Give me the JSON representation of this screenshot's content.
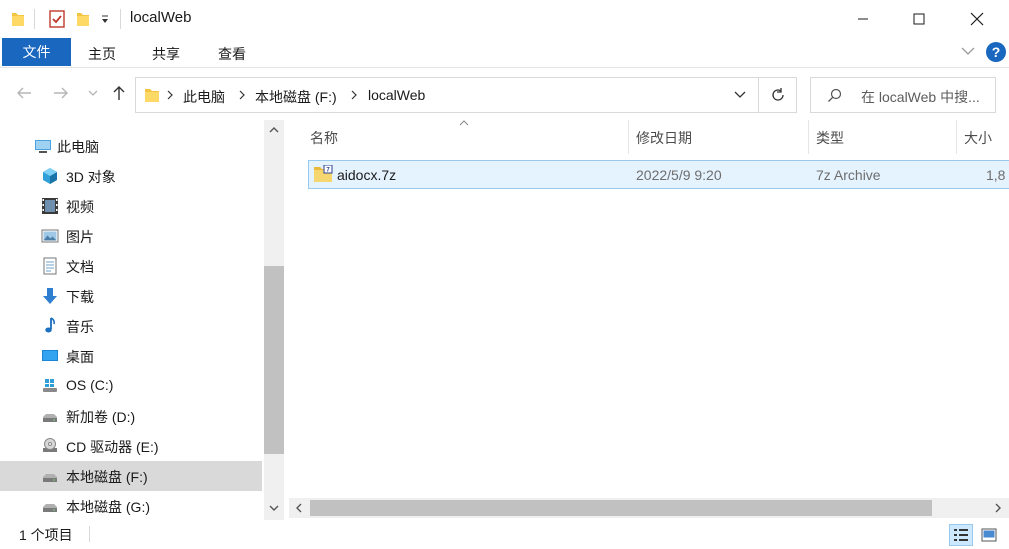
{
  "window": {
    "title": "localWeb",
    "quick_access": [
      "folder-icon",
      "properties-check-icon",
      "new-folder-icon",
      "customize-dropdown-icon"
    ]
  },
  "ribbon": {
    "file_tab": "文件",
    "tabs": [
      "主页",
      "共享",
      "查看"
    ],
    "help": "?"
  },
  "address": {
    "parts": [
      "此电脑",
      "本地磁盘 (F:)",
      "localWeb"
    ]
  },
  "search": {
    "placeholder": "在 localWeb 中搜..."
  },
  "nav": {
    "items": [
      {
        "label": "此电脑",
        "icon": "computer-icon"
      },
      {
        "label": "3D 对象",
        "icon": "cube-3d-icon"
      },
      {
        "label": "视频",
        "icon": "film-icon"
      },
      {
        "label": "图片",
        "icon": "picture-icon"
      },
      {
        "label": "文档",
        "icon": "document-icon"
      },
      {
        "label": "下载",
        "icon": "download-arrow-icon"
      },
      {
        "label": "音乐",
        "icon": "music-note-icon"
      },
      {
        "label": "桌面",
        "icon": "desktop-icon"
      },
      {
        "label": "OS (C:)",
        "icon": "windows-drive-icon"
      },
      {
        "label": "新加卷 (D:)",
        "icon": "drive-icon"
      },
      {
        "label": "CD 驱动器 (E:)",
        "icon": "cd-drive-icon"
      },
      {
        "label": "本地磁盘 (F:)",
        "icon": "drive-icon",
        "selected": true
      },
      {
        "label": "本地磁盘 (G:)",
        "icon": "drive-icon"
      }
    ]
  },
  "columns": {
    "name": "名称",
    "date": "修改日期",
    "type": "类型",
    "size": "大小"
  },
  "files": [
    {
      "name": "aidocx.7z",
      "date": "2022/5/9 9:20",
      "type": "7z Archive",
      "size": "1,8"
    }
  ],
  "status": {
    "count": "1 个项目"
  },
  "colors": {
    "accent": "#1a67bf",
    "selection": "#e5f3ff",
    "selection_border": "#99c9ef",
    "nav_selected": "#d9d9d9"
  }
}
